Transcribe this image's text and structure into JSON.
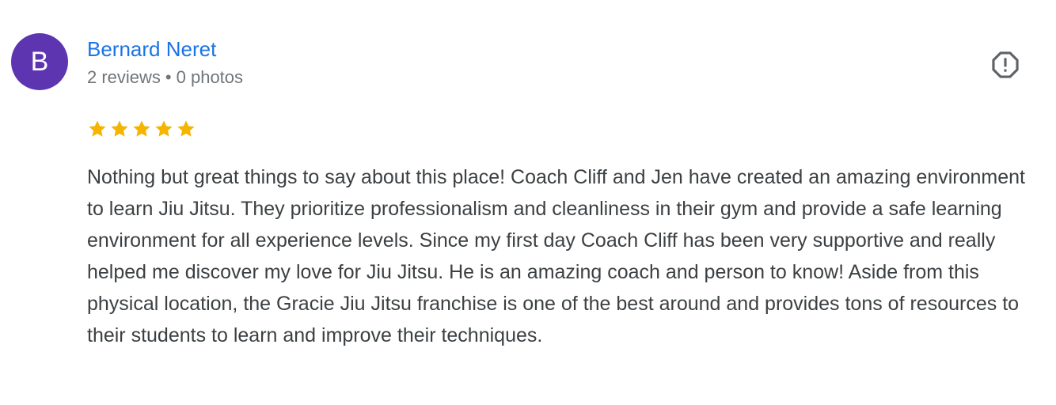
{
  "review": {
    "avatar_letter": "B",
    "avatar_color": "#5e35b1",
    "reviewer_name": "Bernard Neret",
    "reviews_count": "2 reviews",
    "separator": "•",
    "photos_count": "0 photos",
    "rating": 5,
    "rating_max": 5,
    "star_color": "#f4b400",
    "report_icon": "report-flag-octagon-icon",
    "text": "Nothing but great things to say about this place! Coach Cliff and Jen have created an amazing environment to learn Jiu Jitsu. They prioritize professionalism and cleanliness in their gym and provide a safe learning environment for all experience levels. Since my first day Coach Cliff has been very supportive and really helped me discover my love for Jiu Jitsu. He is an amazing coach and person to know! Aside from this physical location, the Gracie Jiu Jitsu franchise is one of the best around and provides tons of resources to their students to learn and improve their techniques."
  }
}
